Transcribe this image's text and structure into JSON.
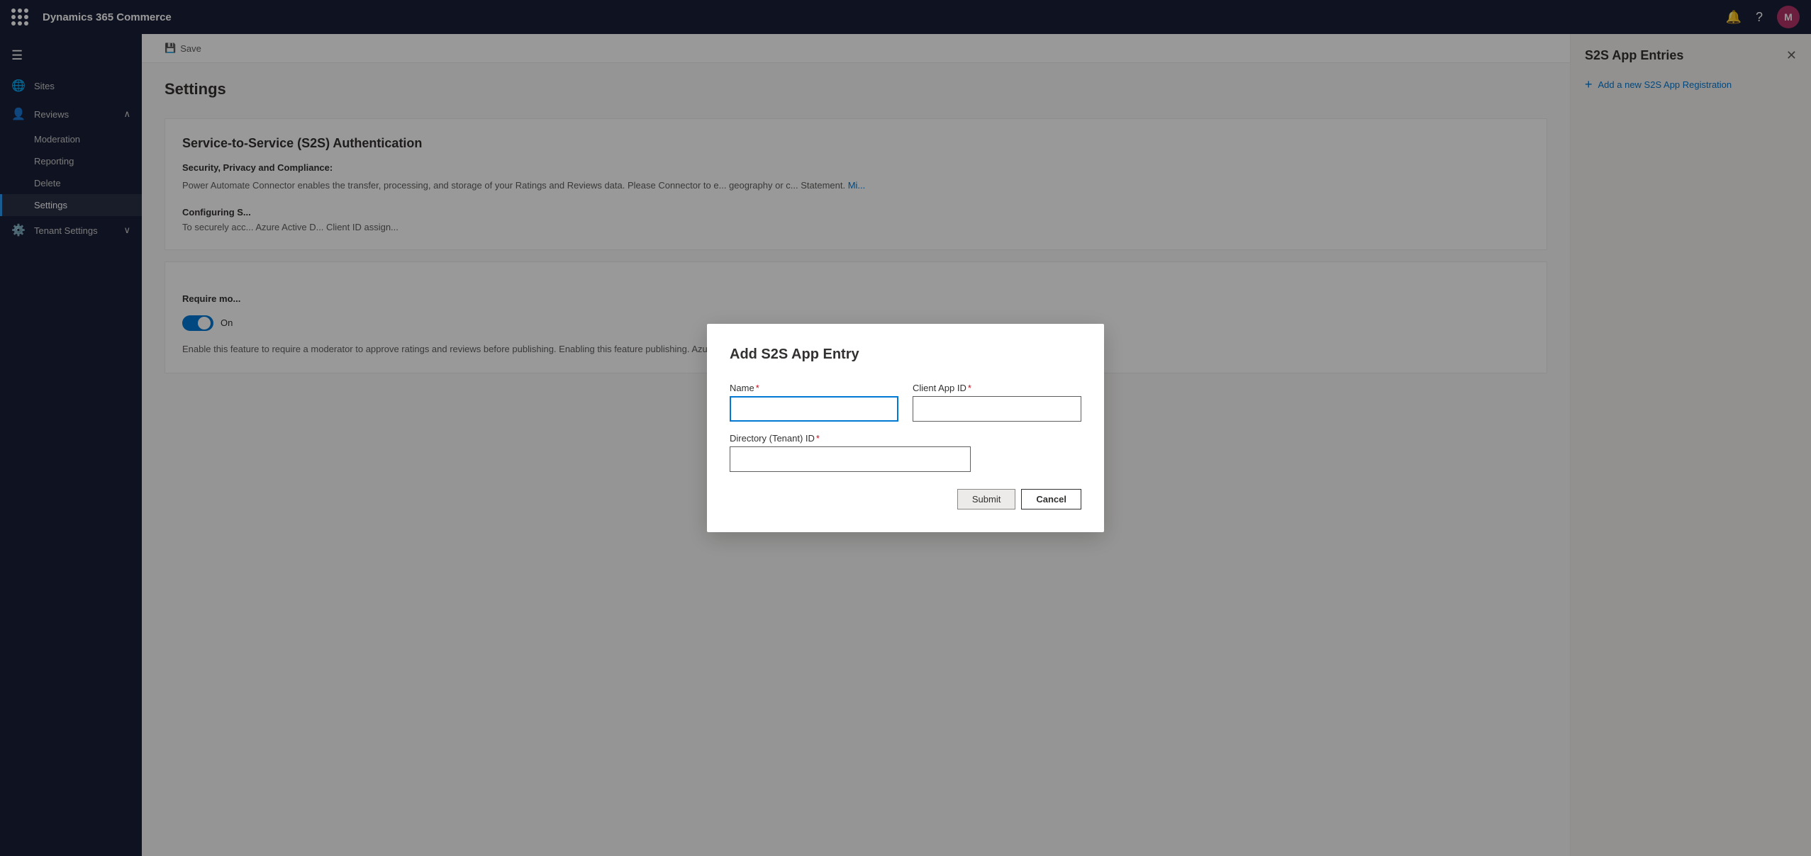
{
  "app": {
    "title": "Dynamics 365 Commerce"
  },
  "topbar": {
    "title": "Dynamics 365 Commerce",
    "avatar_letter": "M",
    "notification_icon": "🔔",
    "help_icon": "?"
  },
  "sidebar": {
    "items": [
      {
        "id": "sites",
        "label": "Sites",
        "icon": "🌐"
      },
      {
        "id": "reviews",
        "label": "Reviews",
        "icon": "👤",
        "expanded": true
      },
      {
        "id": "moderation",
        "label": "Moderation",
        "sub": true
      },
      {
        "id": "reporting",
        "label": "Reporting",
        "sub": true
      },
      {
        "id": "delete",
        "label": "Delete",
        "sub": true
      },
      {
        "id": "settings",
        "label": "Settings",
        "sub": true,
        "active": true
      },
      {
        "id": "tenant-settings",
        "label": "Tenant Settings",
        "icon": "⚙️"
      }
    ]
  },
  "toolbar": {
    "save_label": "Save",
    "save_icon": "💾"
  },
  "page": {
    "title": "Settings",
    "section_title": "Service-to-Service (S2S) Authentication",
    "privacy_label": "Security, Privacy and Compliance:",
    "privacy_text": "Power Automate Connector enables the transfer, processing, and storage of your Ratings and Reviews data. Please Connector to e... geography or c... Statement. Mi...",
    "config_label": "Configuring S...",
    "config_text": "To securely acc... Azure Active D... Client ID assign...",
    "require_label": "Require mo...",
    "toggle_state": "On",
    "enable_text": "Enable this feature to require a moderator to approve ratings and reviews before publishing. Enabling this feature publishing. Azure Cognitive Services will continue to filter profanity in titles and content..."
  },
  "right_panel": {
    "title": "S2S App Entries",
    "add_label": "Add a new S2S App Registration",
    "close_icon": "✕"
  },
  "modal": {
    "title": "Add S2S App Entry",
    "name_label": "Name",
    "name_required": "*",
    "client_app_id_label": "Client App ID",
    "client_app_id_required": "*",
    "directory_tenant_id_label": "Directory (Tenant) ID",
    "directory_tenant_id_required": "*",
    "submit_label": "Submit",
    "cancel_label": "Cancel"
  }
}
